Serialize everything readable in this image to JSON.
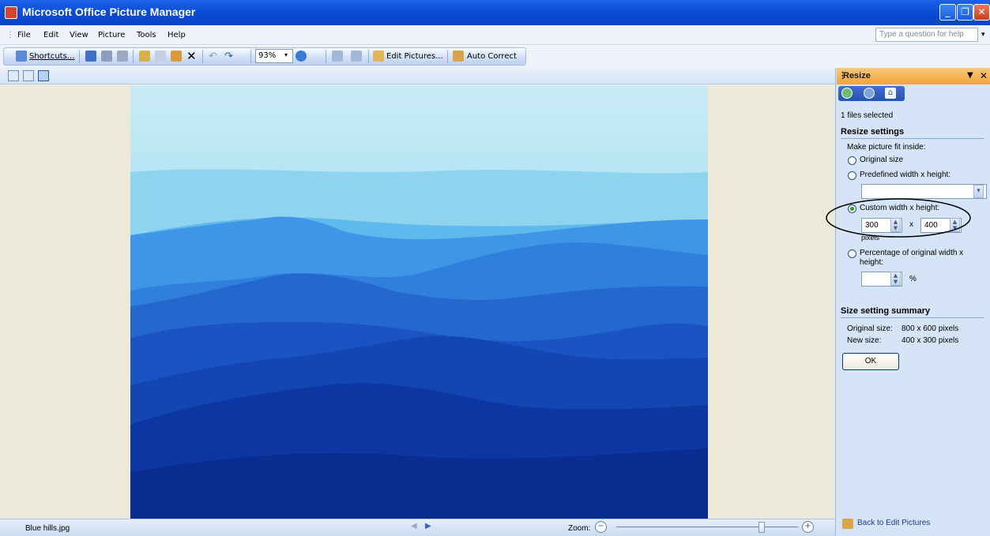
{
  "window": {
    "title": "Microsoft Office Picture Manager"
  },
  "menu": {
    "items": [
      "File",
      "Edit",
      "View",
      "Picture",
      "Tools",
      "Help"
    ],
    "help_placeholder": "Type a question for help"
  },
  "toolbar": {
    "shortcuts": "Shortcuts...",
    "zoom": "93%",
    "edit_pictures": "Edit Pictures...",
    "auto_correct": "Auto Correct"
  },
  "status": {
    "filename": "Blue hills.jpg",
    "zoom_label": "Zoom:",
    "zoom_level": 0.8
  },
  "pane": {
    "title": "Resize",
    "files_selected": "1 files selected",
    "resize_settings": "Resize settings",
    "fit_inside": "Make picture fit inside:",
    "original_size": "Original size",
    "predefined": "Predefined width x height:",
    "custom": "Custom width x height:",
    "width": "300",
    "x_sep": "x",
    "height": "400",
    "pixels": "pixels",
    "percentage_line1": "Percentage of original width x",
    "percentage_line2": "height:",
    "percent_sign": "%",
    "summary_title": "Size setting summary",
    "original_label": "Original size:",
    "original_value": "800 x 600 pixels",
    "new_label": "New size:",
    "new_value": "400 x 300 pixels",
    "ok": "OK",
    "back": "Back to Edit Pictures"
  },
  "colors": {
    "title_bar": "#0a4bd6",
    "pane_header": "#f2a43a",
    "pane_bg": "#d6e4f7",
    "canvas_bg": "#ece9d8"
  }
}
